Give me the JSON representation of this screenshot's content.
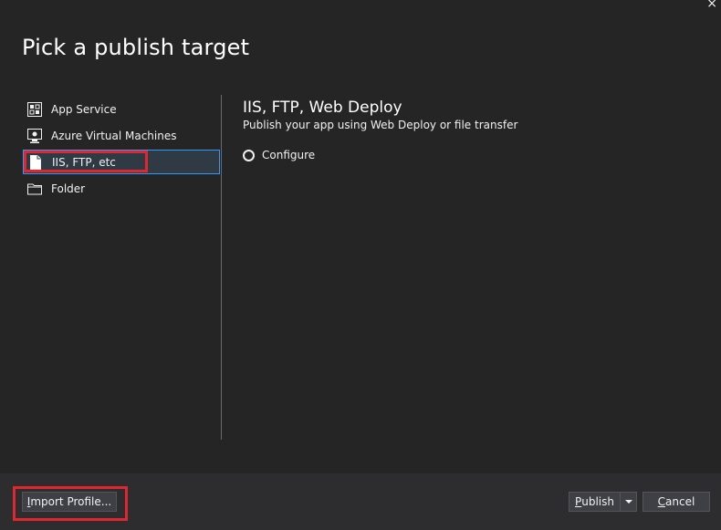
{
  "window": {
    "close_glyph": "×"
  },
  "page_title": "Pick a publish target",
  "targets": [
    {
      "label": "App Service",
      "icon": "app-service-icon",
      "selected": false
    },
    {
      "label": "Azure Virtual Machines",
      "icon": "virtual-machine-icon",
      "selected": false
    },
    {
      "label": "IIS, FTP, etc",
      "icon": "file-icon",
      "selected": true
    },
    {
      "label": "Folder",
      "icon": "folder-icon",
      "selected": false
    }
  ],
  "detail": {
    "title": "IIS, FTP, Web Deploy",
    "subtitle": "Publish your app using Web Deploy or file transfer",
    "option_label": "Configure"
  },
  "footer": {
    "import_label_accel": "I",
    "import_label_rest": "mport Profile...",
    "publish_label_accel": "P",
    "publish_label_rest": "ublish",
    "cancel_label_accel": "C",
    "cancel_label_rest": "ancel"
  },
  "colors": {
    "background": "#252526",
    "footer": "#2d2d30",
    "highlight": "#e0262f",
    "selection_border": "#3399ff"
  }
}
